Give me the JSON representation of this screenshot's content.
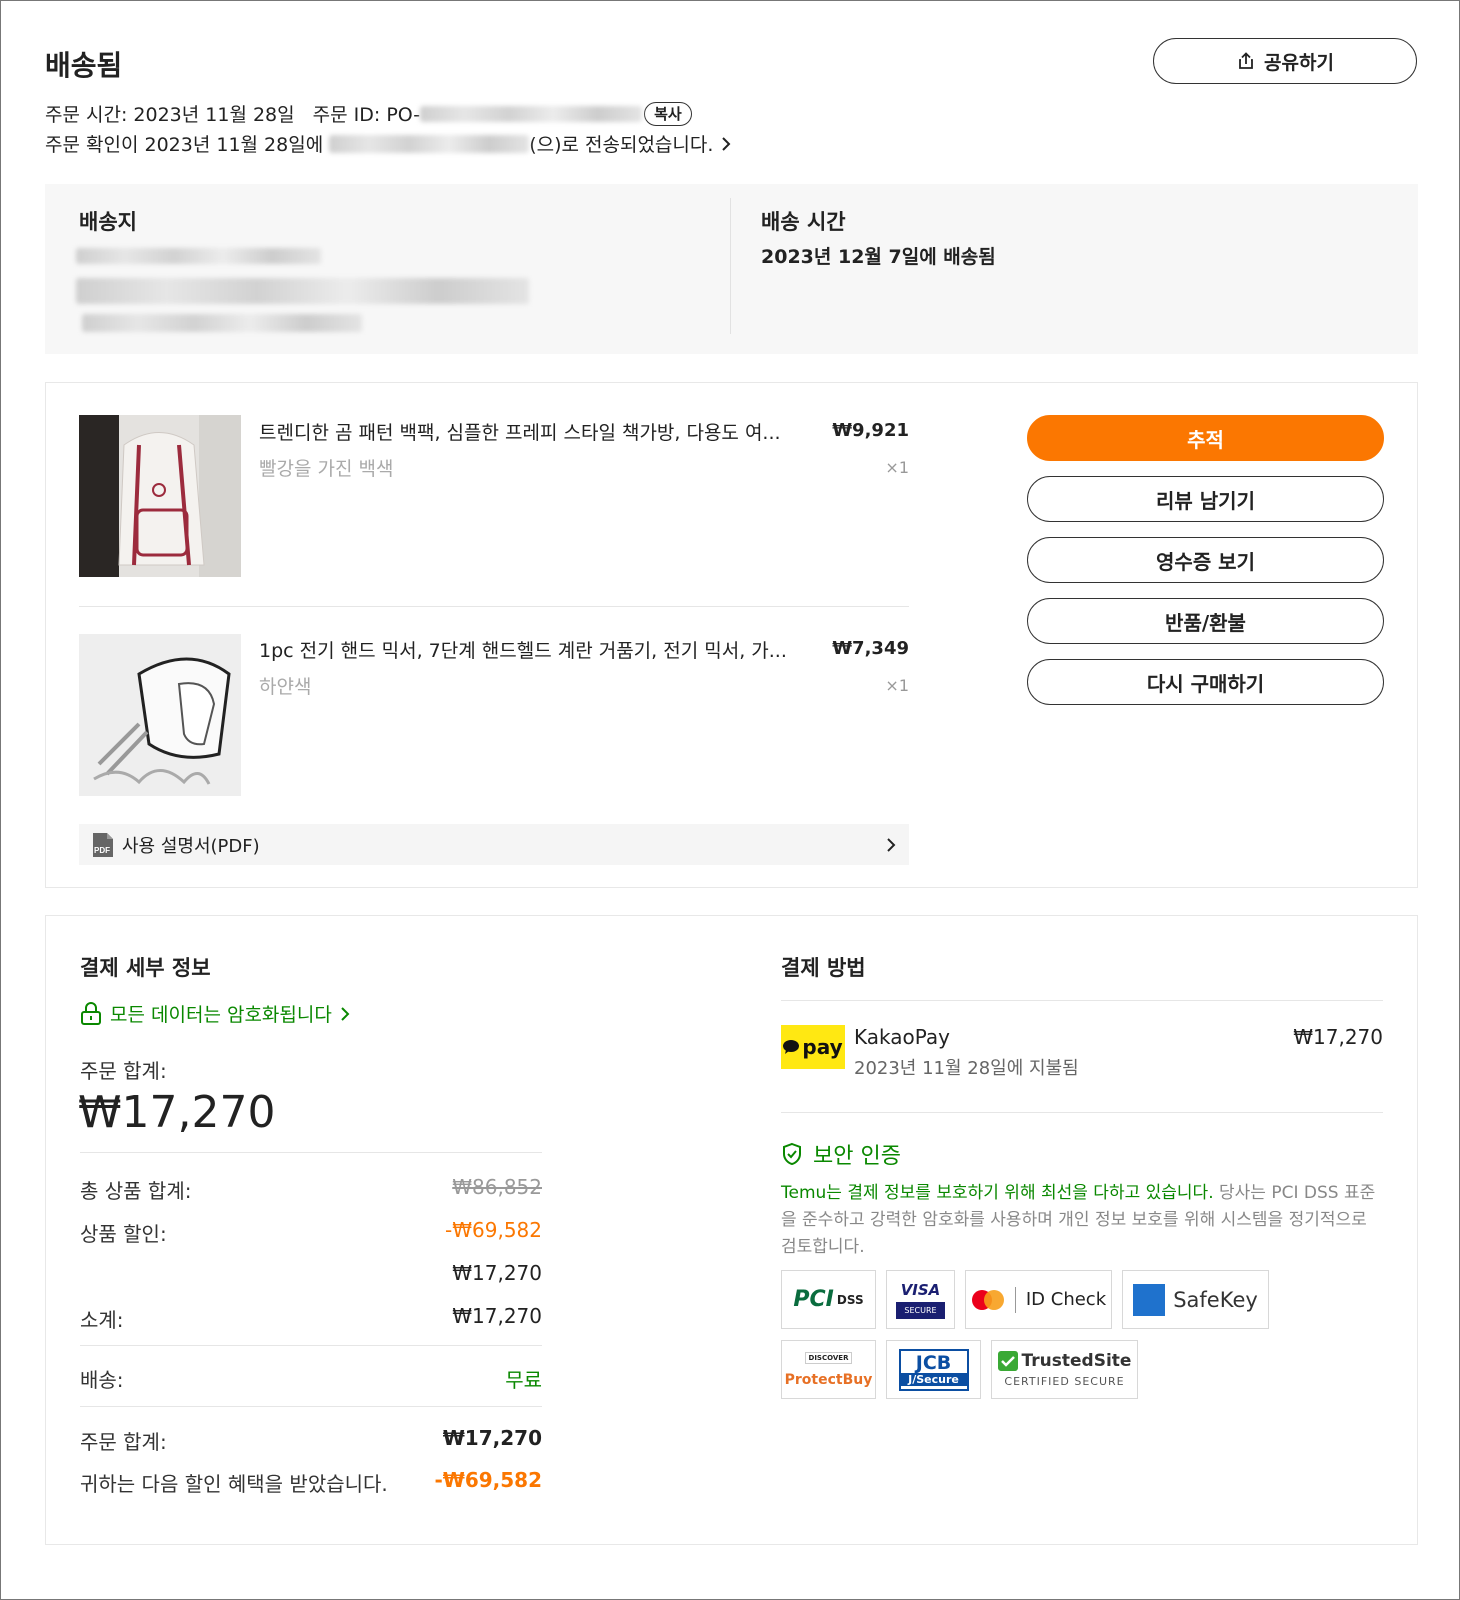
{
  "header": {
    "title": "배송됨",
    "share_label": "공유하기",
    "order_time_label": "주문 시간: 2023년 11월 28일",
    "order_id_label": "주문 ID: PO-",
    "copy_label": "복사",
    "confirm_prefix": "주문 확인이 2023년 11월 28일에",
    "confirm_suffix": "(으)로 전송되었습니다."
  },
  "shipping": {
    "address_title": "배송지",
    "time_title": "배송 시간",
    "time_value": "2023년 12월 7일에 배송됨"
  },
  "items": [
    {
      "name": "트렌디한 곰 패턴 백팩, 심플한 프레피 스타일 책가방, 다용도 여...",
      "variant": "빨강을 가진 백색",
      "price": "₩9,921",
      "qty": "×1"
    },
    {
      "name": "1pc 전기 핸드 믹서, 7단계 핸드헬드 계란 거품기, 전기 믹서, 가...",
      "variant": "하얀색",
      "price": "₩7,349",
      "qty": "×1"
    }
  ],
  "manual_label": "사용 설명서(PDF)",
  "actions": {
    "track": "추적",
    "review": "리뷰 남기기",
    "receipt": "영수증 보기",
    "return": "반품/환불",
    "rebuy": "다시 구매하기"
  },
  "payment_details": {
    "title": "결제 세부 정보",
    "encrypted": "모든 데이터는 암호화됩니다",
    "order_total_label": "주문 합계:",
    "order_total_big": "₩17,270",
    "subtotal_items_label": "총 상품 합계:",
    "subtotal_items_value": "₩86,852",
    "discount_label": "상품 할인:",
    "discount_value": "-₩69,582",
    "after_discount_value": "₩17,270",
    "subtotal_label": "소계:",
    "subtotal_value": "₩17,270",
    "shipping_label": "배송:",
    "shipping_value": "무료",
    "final_total_label": "주문 합계:",
    "final_total_value": "₩17,270",
    "saved_label": "귀하는 다음 할인 혜택을 받았습니다.",
    "saved_value": "-₩69,582"
  },
  "payment_method": {
    "title": "결제 방법",
    "provider_logo": "pay",
    "provider": "KakaoPay",
    "paid_on": "2023년 11월 28일에 지불됨",
    "amount": "₩17,270",
    "security_title": "보안 인증",
    "security_highlight": "Temu는 결제 정보를 보호하기 위해 최선을 다하고 있습니다.",
    "security_text": " 당사는 PCI DSS 표준을 준수하고 강력한 암호화를 사용하며 개인 정보 보호를 위해 시스템을 정기적으로 검토합니다.",
    "badges": {
      "pci": "PCI",
      "pci_dss": "DSS",
      "visa": "VISA",
      "visa_sub": "SECURE",
      "mc": "ID Check",
      "amex": "SafeKey",
      "discover": "DISCOVER",
      "discover_sub": "ProtectBuy",
      "jcb": "JCB",
      "jcb_sub": "J/Secure",
      "trusted": "TrustedSite",
      "trusted_sub": "CERTIFIED SECURE"
    }
  },
  "colors": {
    "accent": "#fb7701",
    "green": "#0a8800",
    "kakao": "#ffe812"
  }
}
